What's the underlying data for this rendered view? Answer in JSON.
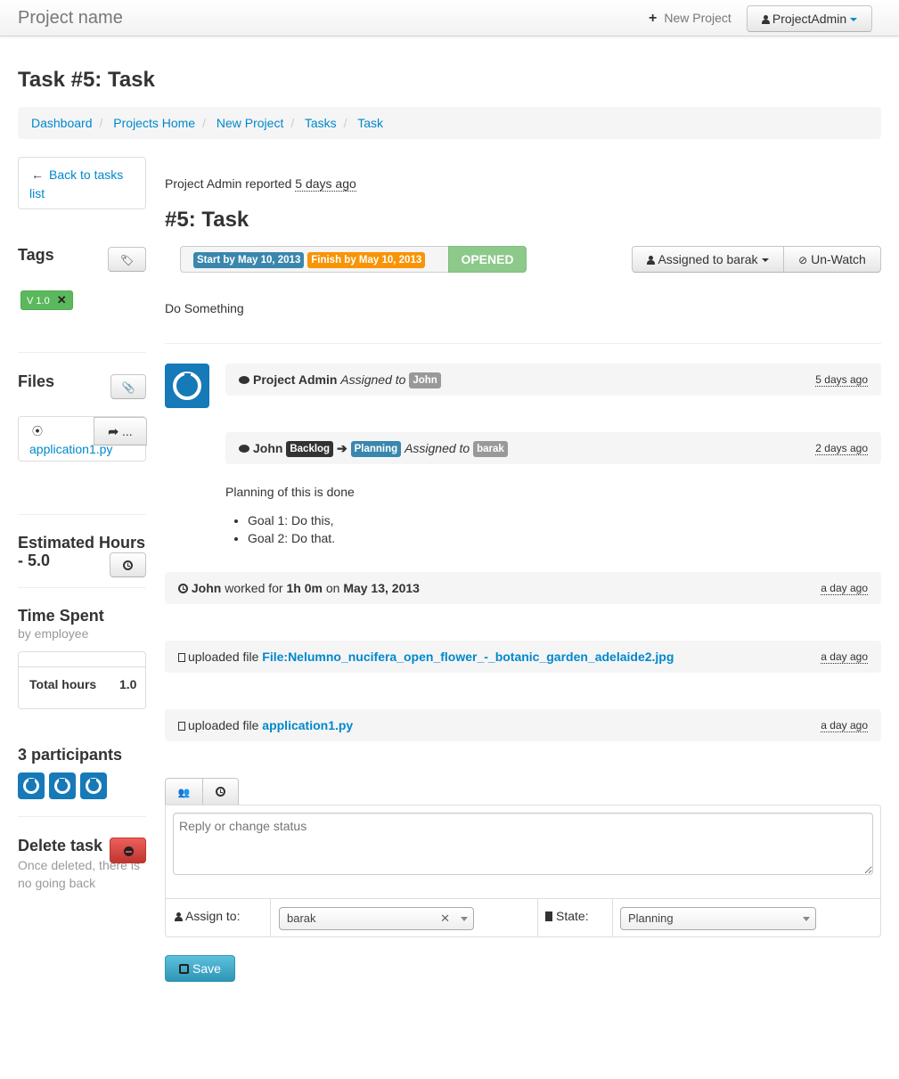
{
  "navbar": {
    "brand": "Project name",
    "new_project": "New Project",
    "user": "ProjectAdmin"
  },
  "page_title": "Task #5: Task",
  "breadcrumb": [
    "Dashboard",
    "Projects Home",
    "New Project",
    "Tasks",
    "Task"
  ],
  "sidebar": {
    "back_label": "Back to tasks list",
    "tags_heading": "Tags",
    "tag": "V 1.0",
    "files_heading": "Files",
    "file_name": "application1.py",
    "file_share": "...",
    "estimated_heading": "Estimated Hours - 5.0",
    "time_spent_heading": "Time Spent",
    "time_spent_sub": "by employee",
    "total_hours_label": "Total hours",
    "total_hours_value": "1.0",
    "participants_heading": "3 participants",
    "delete_heading": "Delete task",
    "delete_note": "Once deleted, there is no going back"
  },
  "task": {
    "reporter": "Project Admin reported",
    "reported_ago": "5 days ago",
    "heading": "#5: Task",
    "start_label": "Start by May 10, 2013",
    "finish_label": "Finish by May 10, 2013",
    "status": "OPENED",
    "assigned_button": "Assigned to barak",
    "watch_button": "Un-Watch",
    "description": "Do Something"
  },
  "activity": [
    {
      "user": "Project Admin",
      "action": "Assigned to",
      "target": "John",
      "time": "5 days ago"
    },
    {
      "user": "John",
      "from_state": "Backlog",
      "to_state": "Planning",
      "action": "Assigned to",
      "target": "barak",
      "time": "2 days ago",
      "comment": "Planning of this is done",
      "bullets": [
        "Goal 1: Do this,",
        "Goal 2: Do that."
      ]
    },
    {
      "user": "John",
      "worked_for": "worked for",
      "duration": "1h 0m",
      "on": "on",
      "date": "May 13, 2013",
      "time": "a day ago"
    },
    {
      "action": "uploaded file",
      "file": "File:Nelumno_nucifera_open_flower_-_botanic_garden_adelaide2.jpg",
      "time": "a day ago"
    },
    {
      "action": "uploaded file",
      "file": "application1.py",
      "time": "a day ago"
    }
  ],
  "reply": {
    "placeholder": "Reply or change status",
    "assign_label": "Assign to:",
    "assign_value": "barak",
    "state_label": "State:",
    "state_value": "Planning",
    "save_label": "Save"
  },
  "colors": {
    "link": "#0088cc",
    "success": "#5cb85c",
    "danger": "#d9534f",
    "info": "#3a87ad",
    "warning": "#f89406"
  }
}
